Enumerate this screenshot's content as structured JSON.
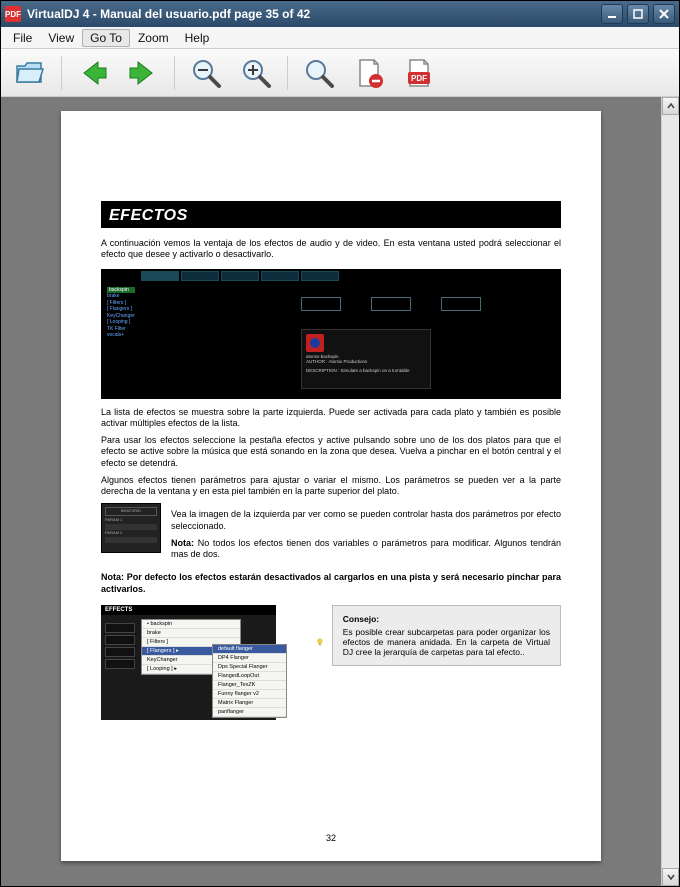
{
  "window": {
    "title": "VirtualDJ 4 - Manual del usuario.pdf page 35 of 42"
  },
  "menu": {
    "file": "File",
    "view": "View",
    "goto": "Go To",
    "zoom": "Zoom",
    "help": "Help"
  },
  "doc": {
    "section_title": "EFECTOS",
    "p1": "A continuación vemos la ventaja de los efectos de audio y de video. En esta ventana usted podrá seleccionar el efecto que desee y activarlo o desactivarlo.",
    "p2": "La lista de efectos se muestra sobre la parte izquierda. Puede ser activada para cada plato y también es posible activar múltiples efectos de la lista.",
    "p3": "Para usar los efectos seleccione la pestaña efectos y active pulsando sobre uno de los dos platos para que el efecto se active sobre la música que está sonando en la zona que desea. Vuelva a pinchar en el botón central y el efecto se detendrá.",
    "p4": "Algunos efectos tienen parámetros para ajustar o variar el mismo. Los parámetros se pueden ver a la parte derecha de la ventana y en esta piel también en la parte superior del plato.",
    "p5a": "Vea la imagen de la izquierda  par ver como se pueden controlar hasta dos parámetros por efecto seleccionado.",
    "p5b_label": "Nota:",
    "p5b": " No todos los efectos tienen dos variables o parámetros para modificar. Algunos tendrán mas de dos.",
    "p6": "Nota: Por defecto los efectos estarán desactivados al cargarlos en una pista y será necesario pinchar para activarlos.",
    "tip_head": "Consejo:",
    "tip_body": "Es posible crear subcarpetas para poder organizar los efectos de manera anidada. En la carpeta de Virtual DJ cree la jerarquía de carpetas para tal efecto..",
    "page_number": "32"
  },
  "shot1": {
    "list": [
      "backspin",
      "brake",
      "[ Filters ]",
      "[ Flangers ]",
      "KeyChanger",
      "[ Looping ]",
      "TK Filter",
      "vocals+"
    ],
    "detail_name": "atomix-backspin",
    "detail_author": "AUTHOR : Atomix Productions",
    "detail_desc": "DESCRIPTION : Simulate a backspin on a turntable"
  },
  "shot2": {
    "header": "BEATGRID",
    "rows": [
      "PARAM 1",
      "PARAM 2"
    ]
  },
  "shot3": {
    "header": "EFFECTS",
    "left_menu": [
      "• backspin",
      "brake",
      "[ Filters ]",
      "[ Flangers ]  ▸",
      "KeyChanger",
      "[ Looping ]  ▸"
    ],
    "sub_menu": [
      "default flanger",
      "DP4 Flanger",
      "Dps Special Flanger",
      "FlangedLoopOut",
      "Flanger_TexZK",
      "Funny flanger v2",
      "Matrix Flanger",
      "panflanger"
    ]
  }
}
